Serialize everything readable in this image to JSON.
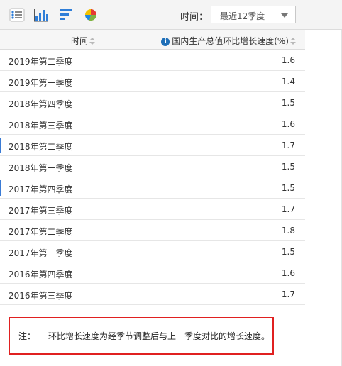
{
  "toolbar": {
    "icons": [
      "list-icon",
      "bar-chart-icon",
      "horizontal-bar-icon",
      "pie-chart-icon"
    ],
    "time_label": "时间：",
    "period_value": "最近12季度"
  },
  "table": {
    "col_time": "时间",
    "col_value": "国内生产总值环比增长速度(%)",
    "rows": [
      {
        "time": "2019年第二季度",
        "value": "1.6"
      },
      {
        "time": "2019年第一季度",
        "value": "1.4"
      },
      {
        "time": "2018年第四季度",
        "value": "1.5"
      },
      {
        "time": "2018年第三季度",
        "value": "1.6"
      },
      {
        "time": "2018年第二季度",
        "value": "1.7"
      },
      {
        "time": "2018年第一季度",
        "value": "1.5"
      },
      {
        "time": "2017年第四季度",
        "value": "1.5"
      },
      {
        "time": "2017年第三季度",
        "value": "1.7"
      },
      {
        "time": "2017年第二季度",
        "value": "1.8"
      },
      {
        "time": "2017年第一季度",
        "value": "1.5"
      },
      {
        "time": "2016年第四季度",
        "value": "1.6"
      },
      {
        "time": "2016年第三季度",
        "value": "1.7"
      }
    ]
  },
  "note": {
    "label": "注：",
    "text": "环比增长速度为经季节调整后与上一季度对比的增长速度。"
  }
}
